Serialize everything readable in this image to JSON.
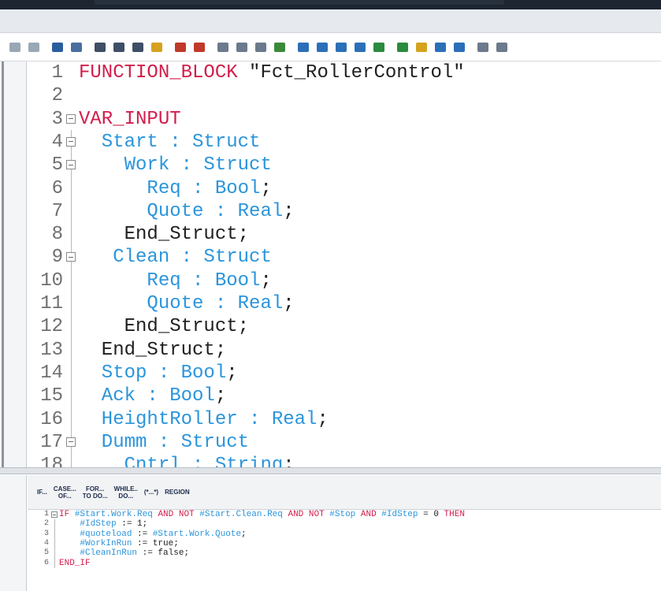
{
  "toolbar": {
    "icons": [
      {
        "name": "indent-icon",
        "color": "#9aa8b6"
      },
      {
        "name": "outdent-icon",
        "color": "#9aa8b6"
      },
      {
        "name": "insert-block-icon",
        "color": "#2c5e9e"
      },
      {
        "name": "variable-icon",
        "color": "#4a6f9e"
      },
      {
        "name": "list-icon",
        "color": "#3f4f65"
      },
      {
        "name": "table-icon",
        "color": "#3f4f65"
      },
      {
        "name": "instance-icon",
        "color": "#3f4f65"
      },
      {
        "name": "highlight-icon",
        "color": "#d6a21e"
      },
      {
        "name": "add-watch-icon",
        "color": "#c0392b"
      },
      {
        "name": "remove-watch-icon",
        "color": "#c0392b"
      },
      {
        "name": "comment-icon",
        "color": "#6b7a8c"
      },
      {
        "name": "uncomment-icon",
        "color": "#6b7a8c"
      },
      {
        "name": "align-icon",
        "color": "#6b7a8c"
      },
      {
        "name": "monitor-icon",
        "color": "#3a8a3a"
      },
      {
        "name": "step-in-icon",
        "color": "#2b6fb8"
      },
      {
        "name": "step-over-icon",
        "color": "#2b6fb8"
      },
      {
        "name": "step-out-icon",
        "color": "#2b6fb8"
      },
      {
        "name": "bookmark-toggle-icon",
        "color": "#2b6fb8"
      },
      {
        "name": "bookmark-prev-icon",
        "color": "#2b8a3e"
      },
      {
        "name": "bookmark-next-icon",
        "color": "#2b8a3e"
      },
      {
        "name": "bookmark-clear-icon",
        "color": "#d6a21e"
      },
      {
        "name": "previous-icon",
        "color": "#2b6fb8"
      },
      {
        "name": "next-icon",
        "color": "#2b6fb8"
      },
      {
        "name": "connection-icon",
        "color": "#6b7a8c"
      },
      {
        "name": "more-icon",
        "color": "#6b7a8c"
      }
    ]
  },
  "code_lines": [
    {
      "num": "1",
      "fold": false,
      "tokens": [
        {
          "text": "FUNCTION_BLOCK ",
          "c": "k"
        },
        {
          "text": "\"Fct_RollerControl\"",
          "c": "d"
        }
      ]
    },
    {
      "num": "2",
      "fold": false,
      "tokens": []
    },
    {
      "num": "3",
      "fold": true,
      "tokens": [
        {
          "text": "VAR_INPUT",
          "c": "k"
        }
      ]
    },
    {
      "num": "4",
      "fold": true,
      "tokens": [
        {
          "text": "  Start : Struct",
          "c": "t"
        }
      ]
    },
    {
      "num": "5",
      "fold": true,
      "tokens": [
        {
          "text": "    Work : Struct",
          "c": "t"
        }
      ]
    },
    {
      "num": "6",
      "fold": false,
      "tokens": [
        {
          "text": "      Req : Bool",
          "c": "t"
        },
        {
          "text": ";",
          "c": "d"
        }
      ]
    },
    {
      "num": "7",
      "fold": false,
      "tokens": [
        {
          "text": "      Quote : Real",
          "c": "t"
        },
        {
          "text": ";",
          "c": "d"
        }
      ]
    },
    {
      "num": "8",
      "fold": false,
      "tokens": [
        {
          "text": "    End_Struct;",
          "c": "d"
        }
      ]
    },
    {
      "num": "9",
      "fold": true,
      "tokens": [
        {
          "text": "   Clean : Struct",
          "c": "t"
        }
      ]
    },
    {
      "num": "10",
      "fold": false,
      "tokens": [
        {
          "text": "      Req : Bool",
          "c": "t"
        },
        {
          "text": ";",
          "c": "d"
        }
      ]
    },
    {
      "num": "11",
      "fold": false,
      "tokens": [
        {
          "text": "      Quote : Real",
          "c": "t"
        },
        {
          "text": ";",
          "c": "d"
        }
      ]
    },
    {
      "num": "12",
      "fold": false,
      "tokens": [
        {
          "text": "    End_Struct;",
          "c": "d"
        }
      ]
    },
    {
      "num": "13",
      "fold": false,
      "tokens": [
        {
          "text": "  End_Struct;",
          "c": "d"
        }
      ]
    },
    {
      "num": "14",
      "fold": false,
      "tokens": [
        {
          "text": "  Stop : Bool",
          "c": "t"
        },
        {
          "text": ";",
          "c": "d"
        }
      ]
    },
    {
      "num": "15",
      "fold": false,
      "tokens": [
        {
          "text": "  Ack : Bool",
          "c": "t"
        },
        {
          "text": ";",
          "c": "d"
        }
      ]
    },
    {
      "num": "16",
      "fold": false,
      "tokens": [
        {
          "text": "  HeightRoller : Real",
          "c": "t"
        },
        {
          "text": ";",
          "c": "d"
        }
      ]
    },
    {
      "num": "17",
      "fold": true,
      "tokens": [
        {
          "text": "  Dumm : Struct",
          "c": "t"
        }
      ]
    },
    {
      "num": "18",
      "fold": false,
      "tokens": [
        {
          "text": "    Cntrl : String",
          "c": "t"
        },
        {
          "text": ";",
          "c": "d"
        }
      ]
    }
  ],
  "snippets": [
    {
      "label": "IF..."
    },
    {
      "label": "CASE...\nOF..."
    },
    {
      "label": "FOR...\nTO DO..."
    },
    {
      "label": "WHILE..\nDO..."
    },
    {
      "label": "(*...*)"
    },
    {
      "label": "REGION"
    }
  ],
  "code2_lines": [
    {
      "num": "1",
      "fold": true,
      "tokens": [
        {
          "text": "IF ",
          "c": "k"
        },
        {
          "text": "#Start.Work.Req ",
          "c": "v"
        },
        {
          "text": "AND NOT ",
          "c": "k"
        },
        {
          "text": "#Start.Clean.Req ",
          "c": "v"
        },
        {
          "text": "AND NOT ",
          "c": "k"
        },
        {
          "text": "#Stop ",
          "c": "v"
        },
        {
          "text": "AND ",
          "c": "k"
        },
        {
          "text": "#IdStep",
          "c": "v"
        },
        {
          "text": " = 0 ",
          "c": "s"
        },
        {
          "text": "THEN",
          "c": "k"
        }
      ]
    },
    {
      "num": "2",
      "fold": false,
      "tokens": [
        {
          "text": "    #IdStep",
          "c": "v"
        },
        {
          "text": " := 1;",
          "c": "s"
        }
      ]
    },
    {
      "num": "3",
      "fold": false,
      "tokens": [
        {
          "text": "    #quoteload",
          "c": "v"
        },
        {
          "text": " := ",
          "c": "s"
        },
        {
          "text": "#Start.Work.Quote",
          "c": "v"
        },
        {
          "text": ";",
          "c": "s"
        }
      ]
    },
    {
      "num": "4",
      "fold": false,
      "tokens": [
        {
          "text": "    #WorkInRun",
          "c": "v"
        },
        {
          "text": " := true;",
          "c": "s"
        }
      ]
    },
    {
      "num": "5",
      "fold": false,
      "tokens": [
        {
          "text": "    #CleanInRun",
          "c": "v"
        },
        {
          "text": " := false;",
          "c": "s"
        }
      ]
    },
    {
      "num": "6",
      "fold": false,
      "tokens": [
        {
          "text": "END_IF",
          "c": "k"
        }
      ]
    }
  ]
}
